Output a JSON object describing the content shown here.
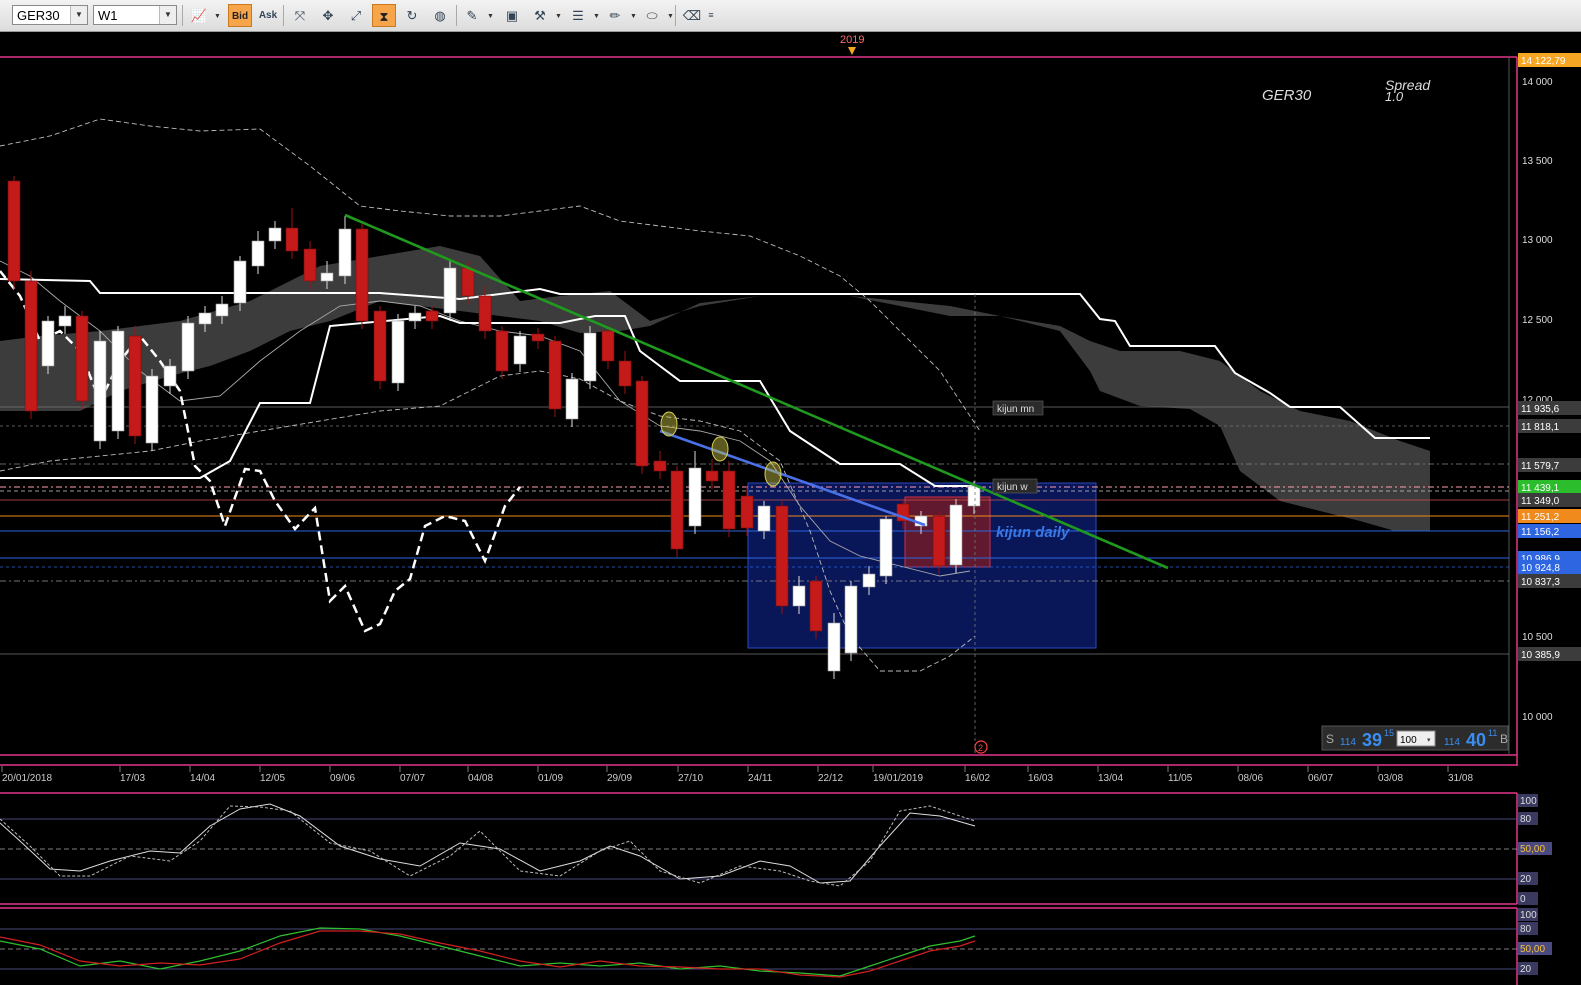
{
  "toolbar": {
    "symbol": "GER30",
    "timeframe": "W1",
    "bid_label": "Bid",
    "ask_label": "Ask",
    "icons": [
      "chart-type-icon",
      "cursor-icon",
      "crosshair-icon",
      "zoom-icon",
      "hourglass-icon",
      "globe-icon",
      "ruler-icon",
      "image-icon",
      "tools-icon",
      "lines-icon",
      "pen-icon",
      "shape-icon",
      "eraser-icon",
      "more-icon"
    ]
  },
  "chart": {
    "symbol_label": "GER30",
    "spread_label": "Spread",
    "spread_value": "1.0",
    "year_marker": "2019",
    "event_marker": "2",
    "price_labels": [
      "14 000",
      "13 500",
      "13 000",
      "12 500",
      "12 000",
      "10 500",
      "10 000"
    ],
    "level_labels": [
      {
        "text": "14 122,79",
        "color": "#f5a623"
      },
      {
        "text": "11 935,6",
        "color": "#3c3c3c"
      },
      {
        "text": "11 818,1",
        "color": "#3c3c3c"
      },
      {
        "text": "11 579,7",
        "color": "#3c3c3c"
      },
      {
        "text": "11 439,1",
        "color": "#2bbd2b"
      },
      {
        "text": "11 349,0",
        "color": "#3c3c3c"
      },
      {
        "text": "11 251,2",
        "color": "#f08a1c"
      },
      {
        "text": "11 156,2",
        "color": "#2d66e0"
      },
      {
        "text": "10 986,9",
        "color": "#2d66e0"
      },
      {
        "text": "10 924,8",
        "color": "#2d66e0"
      },
      {
        "text": "10 837,3",
        "color": "#3c3c3c"
      },
      {
        "text": "10 385,9",
        "color": "#3c3c3c"
      }
    ],
    "date_labels": [
      "20/01/2018",
      "17/03",
      "14/04",
      "12/05",
      "09/06",
      "07/07",
      "04/08",
      "01/09",
      "29/09",
      "27/10",
      "24/11",
      "22/12",
      "19/01/2019",
      "16/02",
      "16/03",
      "13/04",
      "11/05",
      "08/06",
      "06/07",
      "03/08",
      "31/08"
    ],
    "annotations": {
      "kijun_mn": "kijun mn",
      "kijun_w": "kijun w",
      "kijun_daily": "kijun daily"
    },
    "trade": {
      "sell_label": "S",
      "sell_prefix": "114",
      "sell_big": "39",
      "sell_sup": "15",
      "lot": "100",
      "buy_prefix": "114",
      "buy_big": "40",
      "buy_sup": "11",
      "buy_label": "B"
    }
  },
  "stochastic": {
    "scale_labels": [
      "100",
      "80",
      "50,00",
      "20",
      "0"
    ]
  },
  "oscillator": {
    "scale_labels": [
      "100",
      "80",
      "50,00",
      "20"
    ]
  }
}
